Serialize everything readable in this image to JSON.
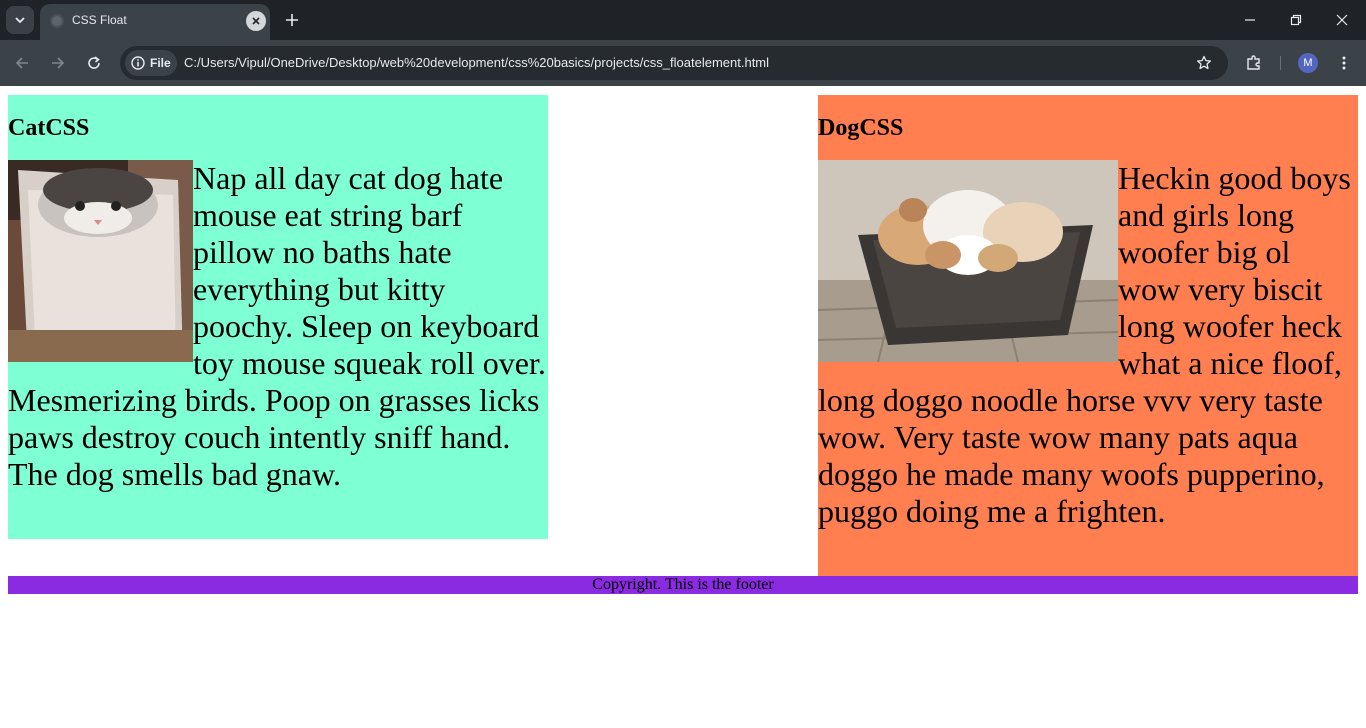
{
  "browser": {
    "tab_title": "CSS Float",
    "site_chip": "File",
    "url": "C:/Users/Vipul/OneDrive/Desktop/web%20development/css%20basics/projects/css_floatelement.html",
    "profile_initial": "M"
  },
  "page": {
    "cat": {
      "heading": "CatCSS",
      "text": "Nap all day cat dog hate mouse eat string barf pillow no baths hate everything but kitty poochy. Sleep on keyboard toy mouse squeak roll over. Mesmerizing birds. Poop on grasses licks paws destroy couch intently sniff hand. The dog smells bad gnaw.",
      "bg_color": "#7fffd4"
    },
    "dog": {
      "heading": "DogCSS",
      "text": "Heckin good boys and girls long woofer big ol wow very biscit long woofer heck what a nice floof, long doggo noodle horse vvv very taste wow. Very taste wow many pats aqua doggo he made many woofs pupperino, puggo doing me a frighten.",
      "bg_color": "#ff7f50"
    },
    "footer": {
      "text": "Copyright. This is the footer",
      "bg_color": "#8a2be2"
    }
  }
}
